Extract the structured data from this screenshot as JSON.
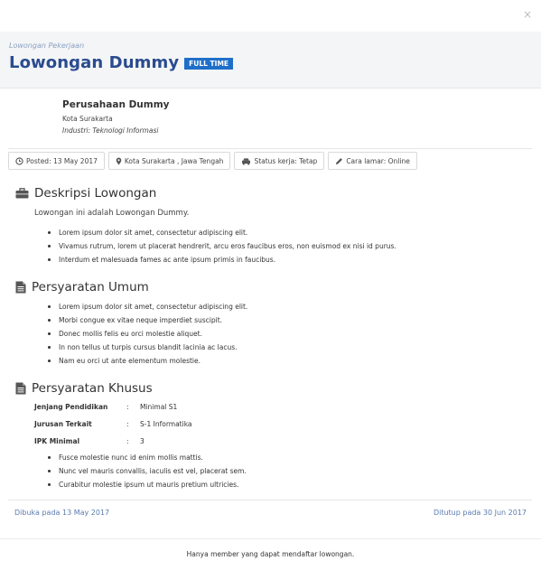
{
  "modal": {
    "close_glyph": "×"
  },
  "header": {
    "breadcrumb": "Lowongan Pekerjaan",
    "title": "Lowongan Dummy",
    "badge": "FULL TIME"
  },
  "company": {
    "name": "Perusahaan Dummy",
    "city": "Kota Surakarta",
    "industry_label": "Industri:",
    "industry_value": "Teknologi Informasi"
  },
  "meta": {
    "posted": "Posted: 13 May 2017",
    "location": "Kota Surakarta , Jawa Tengah",
    "status": "Status kerja: Tetap",
    "apply": "Cara lamar: Online"
  },
  "sections": {
    "description": {
      "title": "Deskripsi Lowongan",
      "text": "Lowongan ini adalah Lowongan Dummy.",
      "bullets": [
        "Lorem ipsum dolor sit amet, consectetur adipiscing elit.",
        "Vivamus rutrum, lorem ut placerat hendrerit, arcu eros faucibus eros, non euismod ex nisi id purus.",
        "Interdum et malesuada fames ac ante ipsum primis in faucibus."
      ]
    },
    "general": {
      "title": "Persyaratan Umum",
      "bullets": [
        "Lorem ipsum dolor sit amet, consectetur adipiscing elit.",
        "Morbi congue ex vitae neque imperdiet suscipit.",
        "Donec mollis felis eu orci molestie aliquet.",
        "In non tellus ut turpis cursus blandit lacinia ac lacus.",
        "Nam eu orci ut ante elementum molestie."
      ]
    },
    "special": {
      "title": "Persyaratan Khusus",
      "rows": [
        {
          "label": "Jenjang Pendidikan",
          "colon": ":",
          "value": "Minimal S1"
        },
        {
          "label": "Jurusan Terkait",
          "colon": ":",
          "value": "S-1 Informatika"
        },
        {
          "label": "IPK Minimal",
          "colon": ":",
          "value": "3"
        }
      ],
      "bullets": [
        "Fusce molestie nunc id enim mollis mattis.",
        "Nunc vel mauris convallis, iaculis est vel, placerat sem.",
        "Curabitur molestie ipsum ut mauris pretium ultricies."
      ]
    }
  },
  "footer": {
    "opened": "Dibuka pada 13 May 2017",
    "closed": "Ditutup pada 30 Jun 2017",
    "note": "Hanya member yang dapat mendaftar lowongan."
  },
  "colors": {
    "title": "#2a4b8f",
    "badge": "#1f6fc9",
    "footer_link": "#5a7bb0",
    "header_bg": "#f4f5f6"
  },
  "icons": {
    "posted": "clock-icon",
    "location": "map-marker-icon",
    "status": "car-icon",
    "apply": "pencil-icon",
    "description": "briefcase-icon",
    "general": "document-icon",
    "special": "document-icon",
    "close": "close-icon"
  }
}
